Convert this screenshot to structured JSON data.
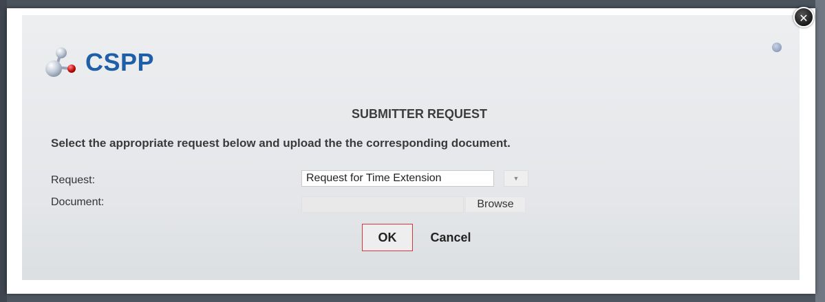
{
  "modal": {
    "close_icon": "close-icon",
    "help_icon": "help-icon"
  },
  "logo": {
    "icon": "molecule-icon",
    "text": "CSPP"
  },
  "dialog": {
    "title": "SUBMITTER REQUEST",
    "instructions": "Select the appropriate request below and upload the the corresponding document."
  },
  "form": {
    "request_label": "Request:",
    "request_value": "Request for Time Extension",
    "document_label": "Document:",
    "document_value": "",
    "browse_label": "Browse"
  },
  "actions": {
    "ok_label": "OK",
    "cancel_label": "Cancel"
  },
  "colors": {
    "brand": "#1f5fa8",
    "ok_border": "#d9343c"
  }
}
